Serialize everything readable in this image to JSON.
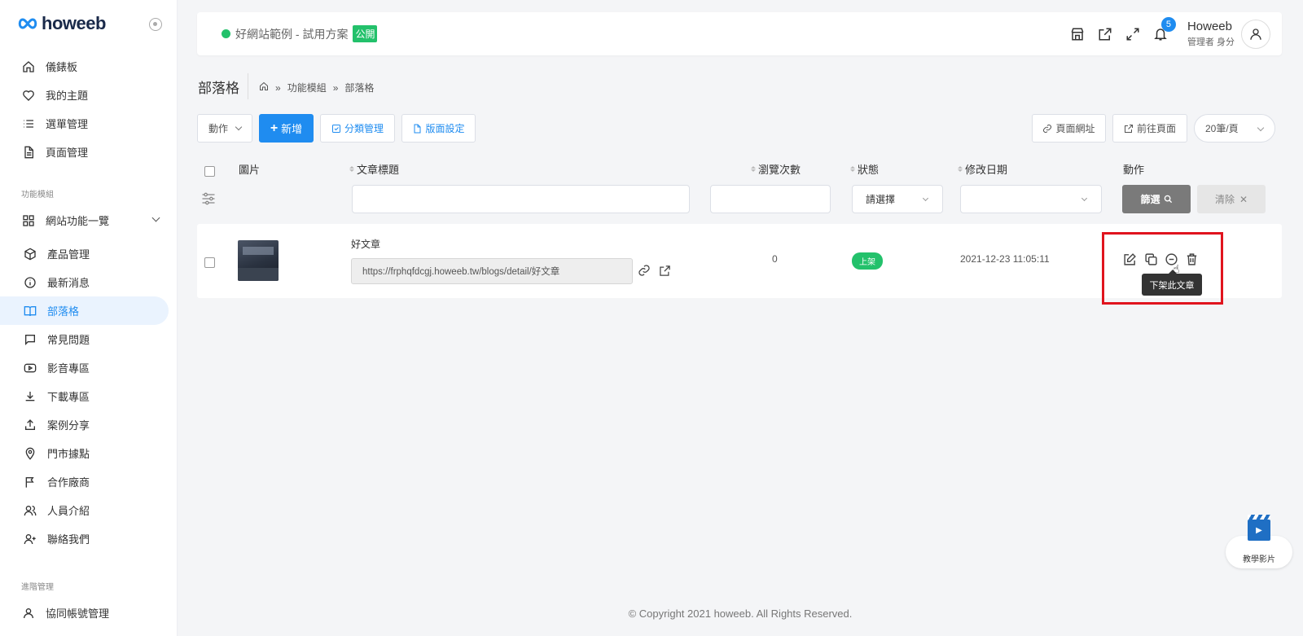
{
  "brand": {
    "logo_text": "howeeb"
  },
  "sidebar": {
    "items": [
      {
        "label": "儀錶板",
        "icon": "home-icon"
      },
      {
        "label": "我的主題",
        "icon": "heart-icon"
      },
      {
        "label": "選單管理",
        "icon": "list-icon"
      },
      {
        "label": "頁面管理",
        "icon": "document-icon"
      }
    ],
    "section_modules": "功能模組",
    "site_features": {
      "label": "網站功能一覽",
      "icon": "grid-icon"
    },
    "modules": [
      {
        "label": "產品管理",
        "icon": "box-icon"
      },
      {
        "label": "最新消息",
        "icon": "info-icon"
      },
      {
        "label": "部落格",
        "icon": "book-icon",
        "active": true
      },
      {
        "label": "常見問題",
        "icon": "chat-icon"
      },
      {
        "label": "影音專區",
        "icon": "youtube-icon"
      },
      {
        "label": "下載專區",
        "icon": "download-icon"
      },
      {
        "label": "案例分享",
        "icon": "share-icon"
      },
      {
        "label": "門市據點",
        "icon": "map-pin-icon"
      },
      {
        "label": "合作廠商",
        "icon": "flag-icon"
      },
      {
        "label": "人員介紹",
        "icon": "users-icon"
      },
      {
        "label": "聯絡我們",
        "icon": "user-plus-icon"
      }
    ],
    "section_admin": "進階管理",
    "admin_items": [
      {
        "label": "協同帳號管理",
        "icon": "user-icon"
      }
    ]
  },
  "header": {
    "site_name": "好網站範例 - 試用方案",
    "public_badge": "公開",
    "notification_count": "5",
    "user_name": "Howeeb",
    "user_role": "管理者 身分"
  },
  "page": {
    "title": "部落格",
    "breadcrumb": [
      "功能模組",
      "部落格"
    ]
  },
  "toolbar": {
    "action_label": "動作",
    "add_label": "新增",
    "category_label": "分類管理",
    "layout_label": "版面設定",
    "page_url_label": "頁面網址",
    "goto_page_label": "前往頁面",
    "per_page": "20筆/頁"
  },
  "table": {
    "columns": {
      "image": "圖片",
      "title": "文章標題",
      "views": "瀏覽次數",
      "status": "狀態",
      "modified": "修改日期",
      "action": "動作"
    },
    "status_placeholder": "請選擇",
    "filter_button": "篩選",
    "clear_button": "清除",
    "rows": [
      {
        "title": "好文章",
        "url": "https://frphqfdcgj.howeeb.tw/blogs/detail/好文章",
        "views": "0",
        "status": "上架",
        "modified": "2021-12-23 11:05:11"
      }
    ],
    "tooltip": "下架此文章"
  },
  "footer": {
    "copyright": "© Copyright 2021 howeeb. All Rights Reserved."
  },
  "video_help": {
    "label": "教學影片"
  },
  "colors": {
    "primary": "#1f8cf0",
    "success": "#23c16b",
    "highlight": "#e0141e"
  }
}
